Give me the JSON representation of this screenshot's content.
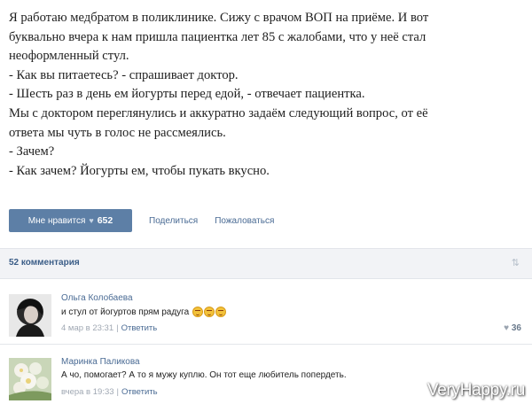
{
  "post": {
    "lines": [
      "Я работаю медбратом в поликлинике. Сижу с врачом ВОП на приёме. И вот",
      "буквально вчера к нам пришла пациентка лет 85 с жалобами, что у неё стал",
      "неоформленный стул.",
      "- Как вы питаетесь? - спрашивает доктор.",
      "- Шесть раз в день ем йогурты перед едой, - отвечает пациентка.",
      "Мы с доктором переглянулись и аккуратно задаём следующий вопрос, от её",
      "ответа мы чуть в голос не рассмеялись.",
      "- Зачем?",
      "- Как зачем? Йогурты ем, чтобы пукать вкусно."
    ]
  },
  "actions": {
    "like_label": "Мне нравится",
    "like_count": "652",
    "heart_icon": "heart-icon",
    "share_label": "Поделиться",
    "report_label": "Пожаловаться"
  },
  "comments_header": {
    "count_label": "52 комментария",
    "sort_icon": "sort-icon"
  },
  "comments": [
    {
      "author": "Ольга Колобаева",
      "text": "и стул от йогуртов прям радуга",
      "emoji_icon": "angry-face-icon",
      "date": "4 мар в 23:31",
      "separator": "|",
      "reply_label": "Ответить",
      "likes": "36"
    },
    {
      "author": "Маринка Паликова",
      "text": "А чо, помогает? А то я мужу куплю. Он тот еще любитель попердеть.",
      "date": "вчера в 19:33",
      "separator": "|",
      "reply_label": "Ответить"
    }
  ],
  "watermark": "VeryHappy.ru",
  "colors": {
    "accent": "#5d7fa6",
    "link": "#4a6b94",
    "bar_bg": "#f2f3f6"
  }
}
